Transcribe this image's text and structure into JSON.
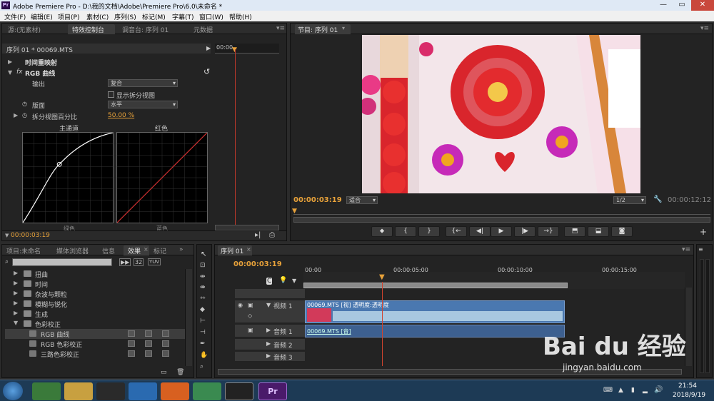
{
  "titlebar": {
    "title": "Adobe Premiere Pro - D:\\我的文档\\Adobe\\Premiere Pro\\6.0\\未命名 *",
    "app_badge": "Pr"
  },
  "menu": [
    "文件(F)",
    "编辑(E)",
    "项目(P)",
    "素材(C)",
    "序列(S)",
    "标记(M)",
    "字幕(T)",
    "窗口(W)",
    "帮助(H)"
  ],
  "effect_controls": {
    "tabs": [
      "源:(无素材)",
      "特效控制台",
      "调音台: 序列 01",
      "元数据"
    ],
    "clip_label": "序列 01 * 00069.MTS",
    "ruler_time": "00:00",
    "time_remap": "时间重映射",
    "fx_badge": "fx",
    "rgb_curves": "RGB 曲线",
    "output_label": "输出",
    "output_value": "复合",
    "split_view_label": "显示拆分视图",
    "layout_label": "版面",
    "layout_value": "水平",
    "split_percent_label": "拆分视图百分比",
    "split_percent_value": "50.00 %",
    "master_label": "主通道",
    "red_label": "红色",
    "master_bottom": "绿色",
    "red_bottom": "蓝色",
    "timecode": "00:00:03:19"
  },
  "program": {
    "tab": "节目: 序列 01",
    "timecode": "00:00:03:19",
    "fit": "适合",
    "quality": "1/2",
    "duration": "00:00:12:12"
  },
  "project": {
    "tabs": [
      "项目:未命名",
      "媒体浏览器",
      "信息",
      "效果",
      "标记"
    ],
    "search_placeholder": "",
    "badges": [
      "32",
      "YUV"
    ],
    "items": [
      {
        "label": "扭曲",
        "type": "folder"
      },
      {
        "label": "时间",
        "type": "folder"
      },
      {
        "label": "杂波与颗粒",
        "type": "folder"
      },
      {
        "label": "模糊与锐化",
        "type": "folder"
      },
      {
        "label": "生成",
        "type": "folder"
      },
      {
        "label": "色彩校正",
        "type": "folder-open"
      },
      {
        "label": "RGB 曲线",
        "type": "effect"
      },
      {
        "label": "RGB 色彩校正",
        "type": "effect"
      },
      {
        "label": "三路色彩校正",
        "type": "effect"
      }
    ]
  },
  "timeline": {
    "tab": "序列 01",
    "timecode": "00:00:03:19",
    "ruler": [
      "00:00",
      "00:00:05:00",
      "00:00:10:00",
      "00:00:15:00"
    ],
    "video_track": "视频 1",
    "audio_track1": "音频 1",
    "audio_track2": "音频 2",
    "audio_track3": "音频 3",
    "video_clip": "00069.MTS [视] 透明度:透明度",
    "audio_clip": "00069.MTS [音]"
  },
  "taskbar": {
    "time": "21:54",
    "date": "2018/9/19",
    "pr_badge": "Pr"
  },
  "watermark": {
    "brand": "Bai du 经验",
    "url": "jingyan.baidu.com"
  },
  "colors": {
    "accent_orange": "#e8a23a",
    "playhead": "#d0432e",
    "clip_blue": "#4a78b0",
    "audio_clip": "#3d6090"
  }
}
